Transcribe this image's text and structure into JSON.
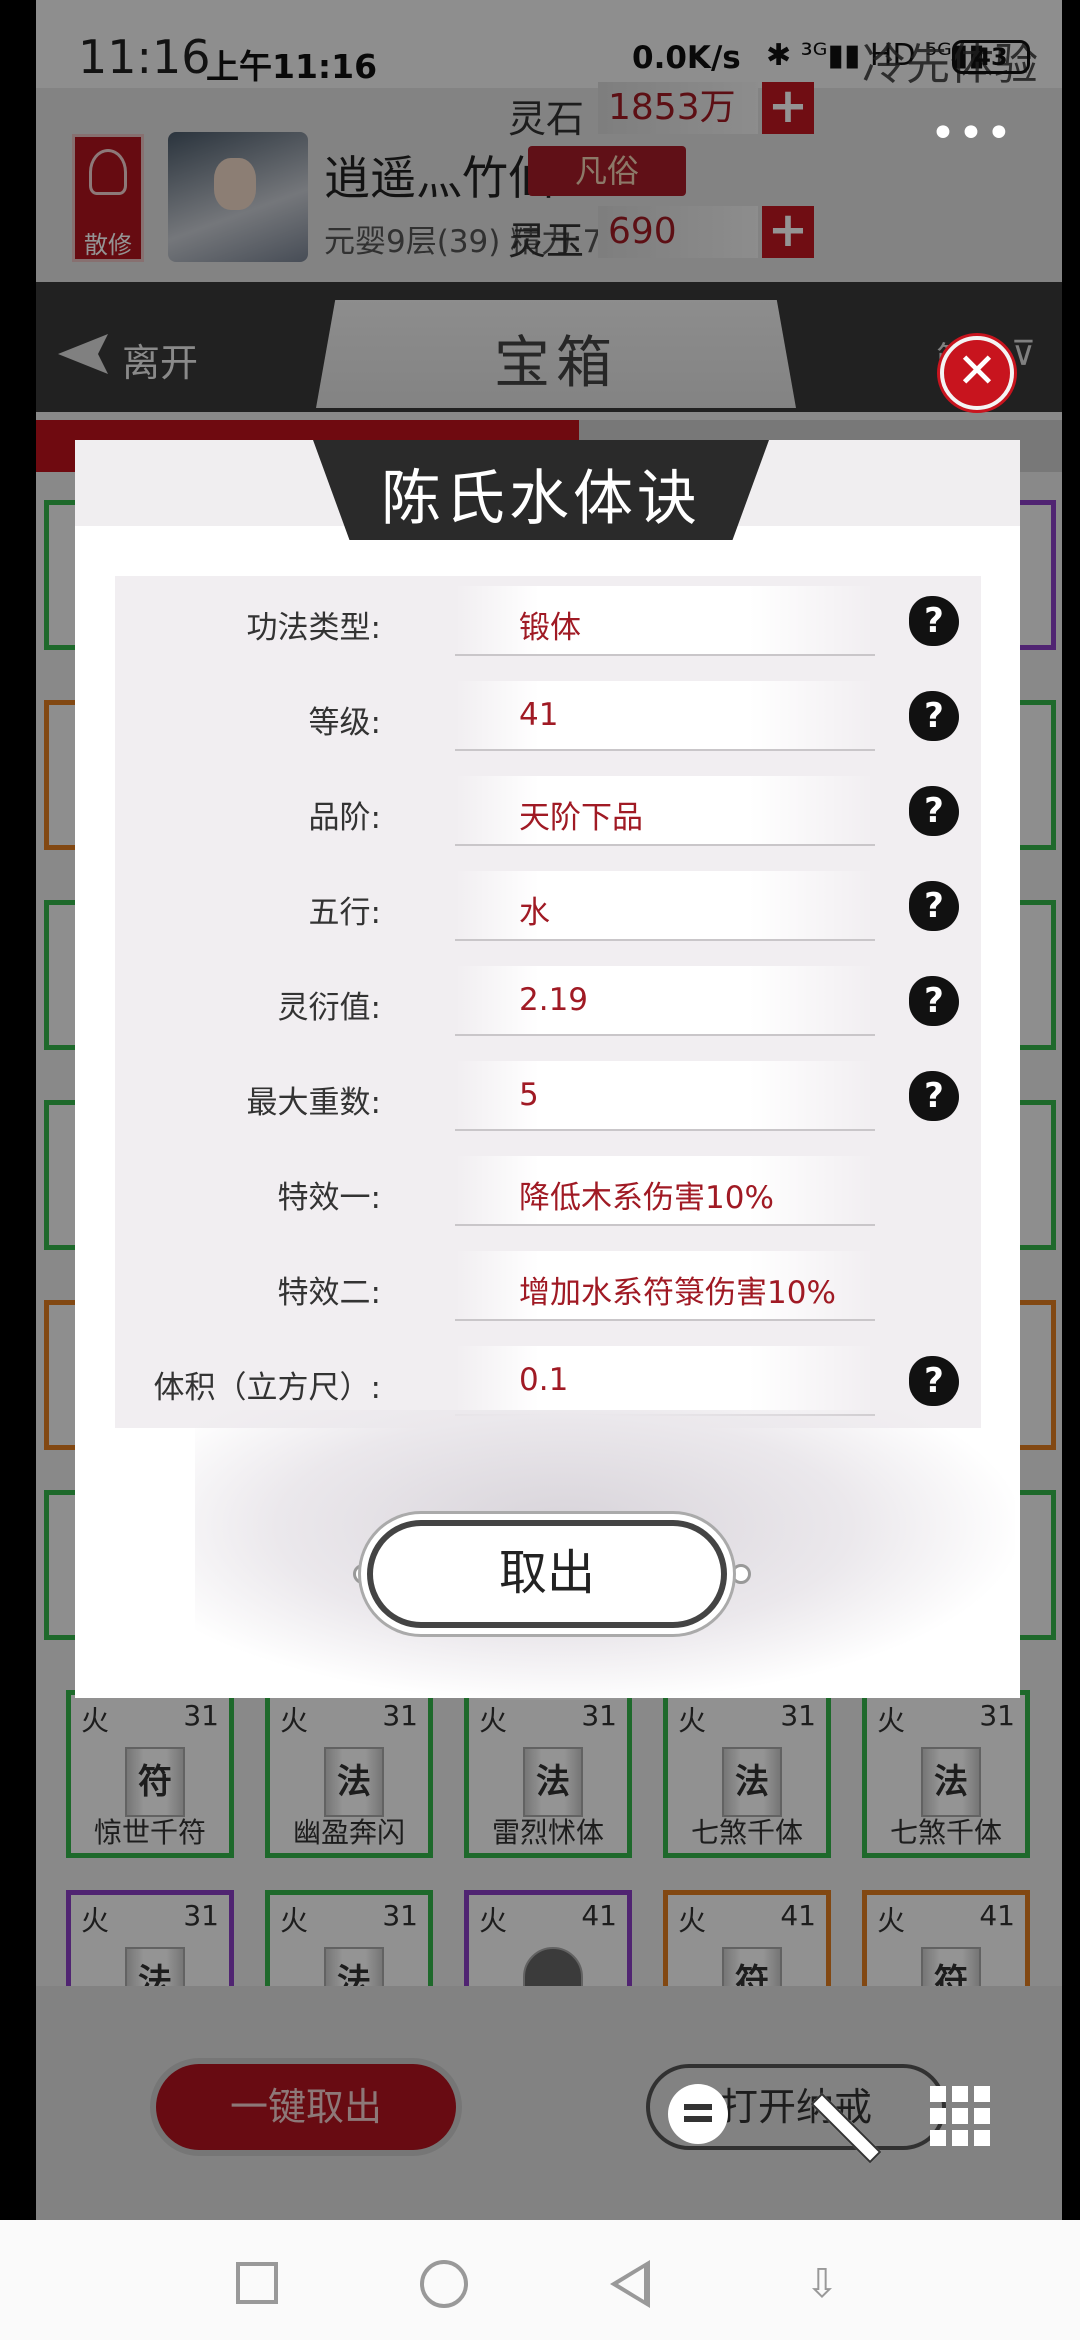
{
  "status_bar": {
    "clock_large": "11:16",
    "clock": "上午11:16",
    "net_speed": "0.0K/s",
    "icons": "✱ ³ᴳ▮▮ HD ⁵ᴳ▮▮",
    "battery": "43",
    "overlay_text": "冷先体验"
  },
  "player": {
    "sect_badge": "散修",
    "name": "逍遥灬竹仙",
    "rank": "凡俗",
    "level": "元婴9层(39)",
    "energy": "精力:7",
    "spirit_stone_label": "灵石",
    "spirit_stone_value": "1853万",
    "spirit_jade_label": "灵玉",
    "spirit_jade_value": "690",
    "plus": "+"
  },
  "nav": {
    "leave": "离开",
    "title": "宝箱",
    "filter": "筛",
    "filter_icon": "⊽"
  },
  "more_menu": "•••",
  "inventory": {
    "row1": [
      {
        "element": "火",
        "level": "31",
        "glyph": "符",
        "name": "惊世千符",
        "border": "#35b54a"
      },
      {
        "element": "火",
        "level": "31",
        "glyph": "法",
        "name": "幽盈奔闪",
        "border": "#35b54a"
      },
      {
        "element": "火",
        "level": "31",
        "glyph": "法",
        "name": "雷烈怵体",
        "border": "#35b54a"
      },
      {
        "element": "火",
        "level": "31",
        "glyph": "法",
        "name": "七煞千体",
        "border": "#35b54a"
      },
      {
        "element": "火",
        "level": "31",
        "glyph": "法",
        "name": "七煞千体",
        "border": "#35b54a"
      }
    ],
    "row2": [
      {
        "element": "火",
        "level": "31",
        "glyph": "法",
        "border": "#8a3fc4"
      },
      {
        "element": "火",
        "level": "31",
        "glyph": "法",
        "border": "#35b54a"
      },
      {
        "element": "火",
        "level": "41",
        "glyph": "",
        "border": "#8a3fc4"
      },
      {
        "element": "火",
        "level": "41",
        "glyph": "符",
        "border": "#e07c20"
      },
      {
        "element": "火",
        "level": "41",
        "glyph": "符",
        "border": "#e07c20"
      }
    ]
  },
  "bottom": {
    "take_all": "一键取出",
    "open_ring": "打开纳戒"
  },
  "modal": {
    "title": "陈氏水体诀",
    "rows": [
      {
        "label": "功法类型:",
        "value": "锻体",
        "help": true
      },
      {
        "label": "等级:",
        "value": "41",
        "help": true
      },
      {
        "label": "品阶:",
        "value": "天阶下品",
        "help": true
      },
      {
        "label": "五行:",
        "value": "水",
        "help": true
      },
      {
        "label": "灵衍值:",
        "value": "2.19",
        "help": true
      },
      {
        "label": "最大重数:",
        "value": "5",
        "help": true
      },
      {
        "label": "特效一:",
        "value": "降低木系伤害10%",
        "help": false
      },
      {
        "label": "特效二:",
        "value": "增加水系符箓伤害10%",
        "help": false
      },
      {
        "label": "体积（立方尺）:",
        "value": "0.1",
        "help": true
      }
    ],
    "help_glyph": "?",
    "take_out": "取出",
    "close": "✕"
  },
  "colors": {
    "accent_red": "#b4141f",
    "value_red": "#a01a24",
    "green_border": "#35b54a",
    "purple_border": "#8a3fc4",
    "orange_border": "#e07c20"
  }
}
